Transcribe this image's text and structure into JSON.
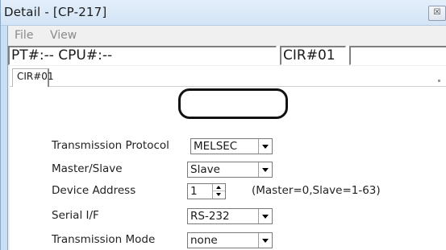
{
  "window": {
    "title": "Detail - [CP-217]",
    "close_glyph": "☒"
  },
  "menu": {
    "file": "File",
    "view": "View"
  },
  "status": {
    "pt_cpu": "PT#:-- CPU#:--",
    "cir": "CIR#01",
    "extra": ""
  },
  "tabs": [
    {
      "label": "CIR#01",
      "selected": true
    }
  ],
  "fields": {
    "transmission_protocol": {
      "label": "Transmission Protocol",
      "value": "MELSEC"
    },
    "master_slave": {
      "label": "Master/Slave",
      "value": "Slave"
    },
    "device_address": {
      "label": "Device Address",
      "value": "1",
      "hint": "(Master=0,Slave=1-63)"
    },
    "serial_if": {
      "label": "Serial I/F",
      "value": "RS-232"
    },
    "transmission_mode": {
      "label": "Transmission Mode",
      "value": "none"
    }
  },
  "icons": {
    "close": "close-icon",
    "dropdown": "chevron-down-icon",
    "spin_up": "spin-up-icon",
    "spin_down": "spin-down-icon"
  },
  "colors": {
    "titlebar": "#d3e4f6",
    "client": "#f0f0f0",
    "highlight": "#111111"
  }
}
